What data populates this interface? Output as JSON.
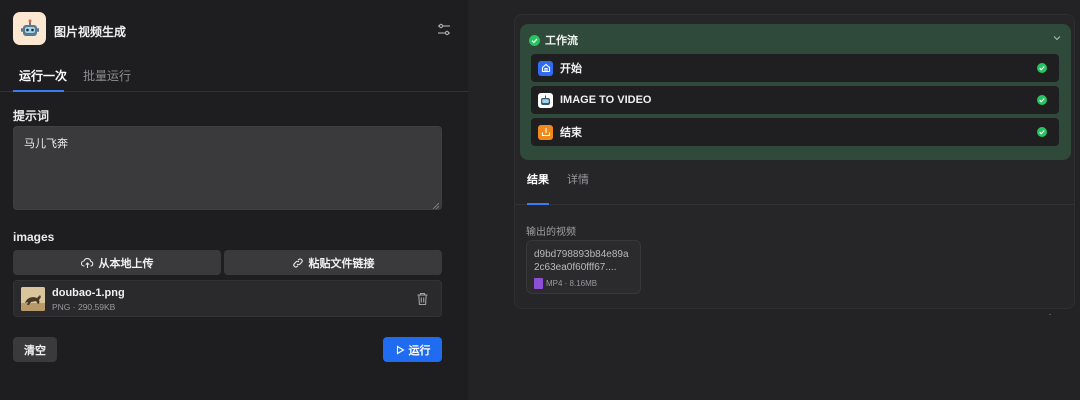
{
  "app": {
    "title": "图片视频生成",
    "icon": "robot-icon"
  },
  "tabs": [
    {
      "label": "运行一次",
      "active": true
    },
    {
      "label": "批量运行",
      "active": false
    }
  ],
  "prompt": {
    "label": "提示词",
    "value": "马儿飞奔"
  },
  "images": {
    "label": "images",
    "upload_local": "从本地上传",
    "paste_link": "粘贴文件链接",
    "file": {
      "name": "doubao-1.png",
      "meta": "PNG · 290.59KB"
    }
  },
  "actions": {
    "clear": "清空",
    "run": "运行"
  },
  "workflow": {
    "title": "工作流",
    "nodes": [
      {
        "label": "开始",
        "icon": "home-icon",
        "color": "#2f6cf0",
        "status": "success"
      },
      {
        "label": "IMAGE TO VIDEO",
        "icon": "robot-icon",
        "color": "#ffffff",
        "status": "success"
      },
      {
        "label": "结束",
        "icon": "end-icon",
        "color": "#f08a1c",
        "status": "success"
      }
    ]
  },
  "result_tabs": [
    {
      "label": "结果",
      "active": true
    },
    {
      "label": "详情",
      "active": false
    }
  ],
  "output": {
    "label": "输出的视频",
    "filename": "d9bd798893b84e89a2c63ea0f60fff67....",
    "type": "MP4",
    "size": "8.16MB",
    "meta": "MP4 · 8.16MB"
  },
  "colors": {
    "accent": "#1f6cf0",
    "success": "#22c55e",
    "workflow_bg": "#2f4a3a"
  }
}
